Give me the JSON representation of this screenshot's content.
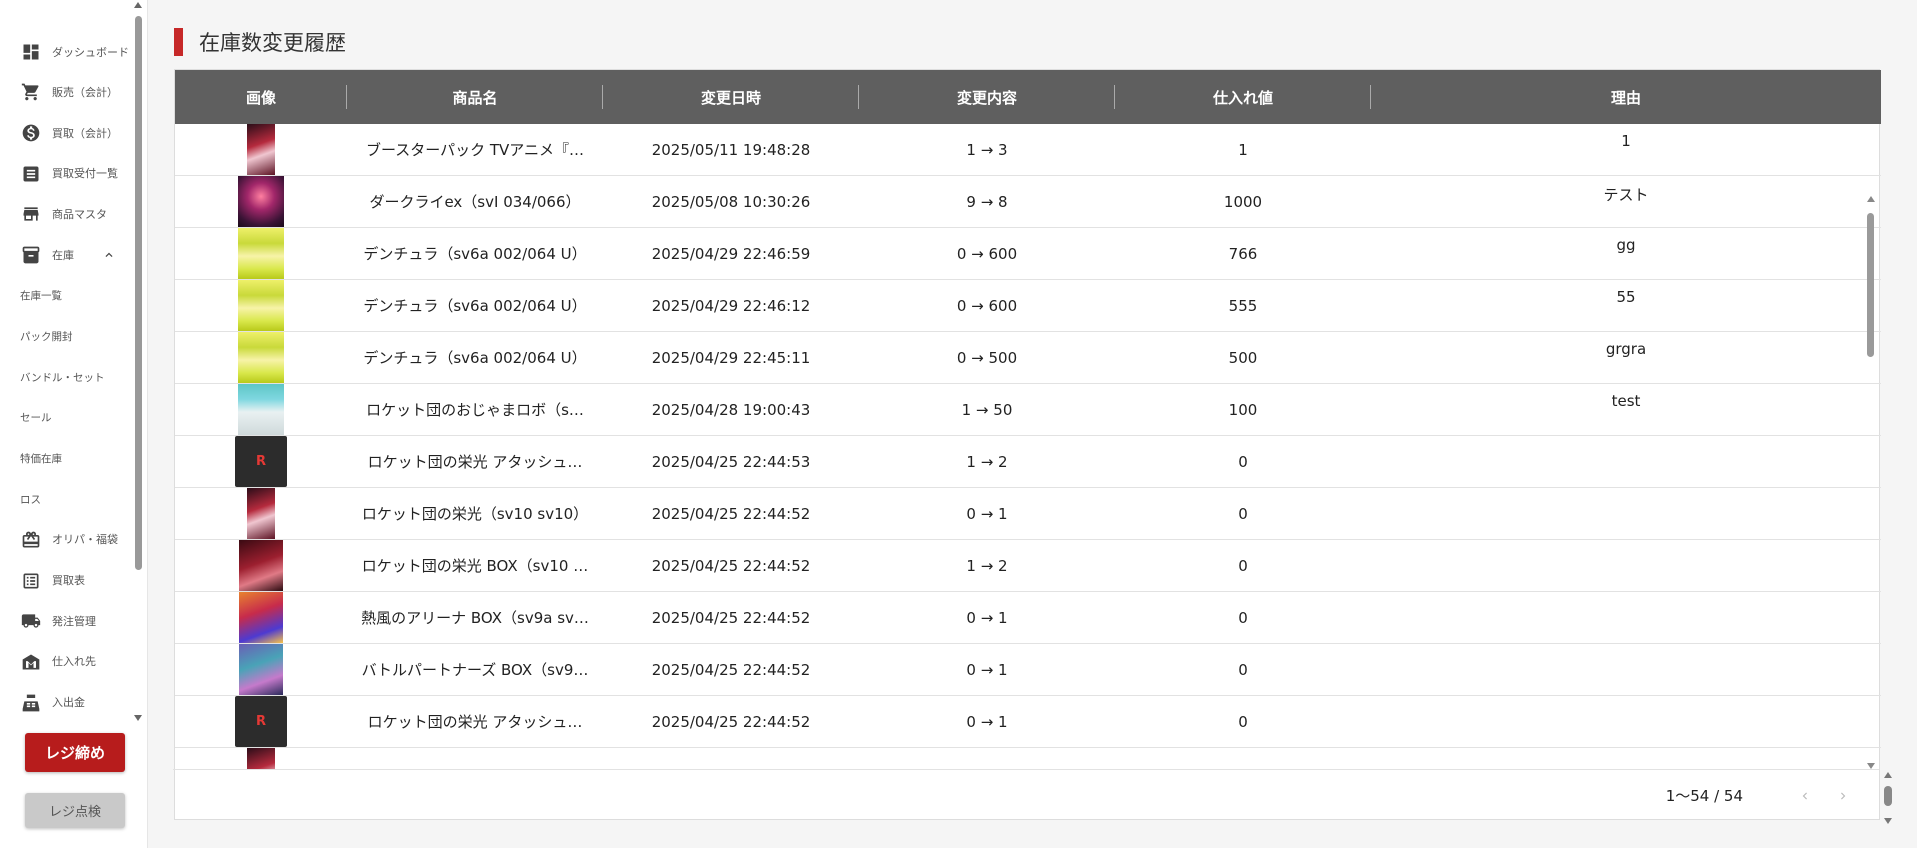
{
  "sidebar": {
    "items": [
      {
        "label": "ダッシュボード",
        "icon": "dashboard-icon"
      },
      {
        "label": "販売（会計）",
        "icon": "cart-icon"
      },
      {
        "label": "買取（会計）",
        "icon": "dollar-icon"
      },
      {
        "label": "買取受付一覧",
        "icon": "receipt-icon"
      },
      {
        "label": "商品マスタ",
        "icon": "store-icon"
      }
    ],
    "group": {
      "label": "在庫",
      "icon": "archive-icon"
    },
    "sub_items": [
      "在庫一覧",
      "パック開封",
      "バンドル・セット",
      "セール",
      "特価在庫",
      "ロス"
    ],
    "more_items": [
      {
        "label": "オリパ・福袋",
        "icon": "gift-icon"
      },
      {
        "label": "買取表",
        "icon": "list-icon"
      },
      {
        "label": "発注管理",
        "icon": "truck-icon"
      },
      {
        "label": "仕入れ先",
        "icon": "warehouse-icon"
      },
      {
        "label": "入出金",
        "icon": "register-icon"
      }
    ],
    "close_register_label": "レジ締め",
    "check_register_label": "レジ点検"
  },
  "page": {
    "title": "在庫数変更履歴"
  },
  "table": {
    "headers": [
      "画像",
      "商品名",
      "変更日時",
      "変更内容",
      "仕入れ値",
      "理由"
    ],
    "rows": [
      {
        "thumb": "pack",
        "name": "ブースターパック TVアニメ『…",
        "datetime": "2025/05/11 19:48:28",
        "change": "1 → 3",
        "price": "1",
        "reason": "1"
      },
      {
        "thumb": "card-dark",
        "name": "ダークライex（svI 034/066）",
        "datetime": "2025/05/08 10:30:26",
        "change": "9 → 8",
        "price": "1000",
        "reason": "テスト"
      },
      {
        "thumb": "card-yellow",
        "name": "デンチュラ（sv6a 002/064 U）",
        "datetime": "2025/04/29 22:46:59",
        "change": "0 → 600",
        "price": "766",
        "reason": "gg"
      },
      {
        "thumb": "card-yellow",
        "name": "デンチュラ（sv6a 002/064 U）",
        "datetime": "2025/04/29 22:46:12",
        "change": "0 → 600",
        "price": "555",
        "reason": "55"
      },
      {
        "thumb": "card-yellow",
        "name": "デンチュラ（sv6a 002/064 U）",
        "datetime": "2025/04/29 22:45:11",
        "change": "0 → 500",
        "price": "500",
        "reason": "grgra"
      },
      {
        "thumb": "card-teal",
        "name": "ロケット団のおじゃまロボ（s…",
        "datetime": "2025/04/28 19:00:43",
        "change": "1 → 50",
        "price": "100",
        "reason": "test"
      },
      {
        "thumb": "box-black",
        "name": "ロケット団の栄光 アタッシュ…",
        "datetime": "2025/04/25 22:44:53",
        "change": "1 → 2",
        "price": "0",
        "reason": ""
      },
      {
        "thumb": "pack",
        "name": "ロケット団の栄光（sv10 sv10）",
        "datetime": "2025/04/25 22:44:52",
        "change": "0 → 1",
        "price": "0",
        "reason": ""
      },
      {
        "thumb": "box-red",
        "name": "ロケット団の栄光 BOX（sv10 …",
        "datetime": "2025/04/25 22:44:52",
        "change": "1 → 2",
        "price": "0",
        "reason": ""
      },
      {
        "thumb": "box-orange",
        "name": "熱風のアリーナ BOX（sv9a sv…",
        "datetime": "2025/04/25 22:44:52",
        "change": "0 → 1",
        "price": "0",
        "reason": ""
      },
      {
        "thumb": "box-purple",
        "name": "バトルパートナーズ BOX（sv9…",
        "datetime": "2025/04/25 22:44:52",
        "change": "0 → 1",
        "price": "0",
        "reason": ""
      },
      {
        "thumb": "box-black",
        "name": "ロケット団の栄光 アタッシュ…",
        "datetime": "2025/04/25 22:44:52",
        "change": "0 → 1",
        "price": "0",
        "reason": ""
      },
      {
        "thumb": "pack",
        "name": "",
        "datetime": "",
        "change": "",
        "price": "",
        "reason": ""
      }
    ]
  },
  "pager": {
    "range_text": "1〜54 / 54"
  },
  "colors": {
    "accent": "#c62828",
    "header_bg": "#5f5f5f",
    "close_button": "#b71c1c"
  }
}
